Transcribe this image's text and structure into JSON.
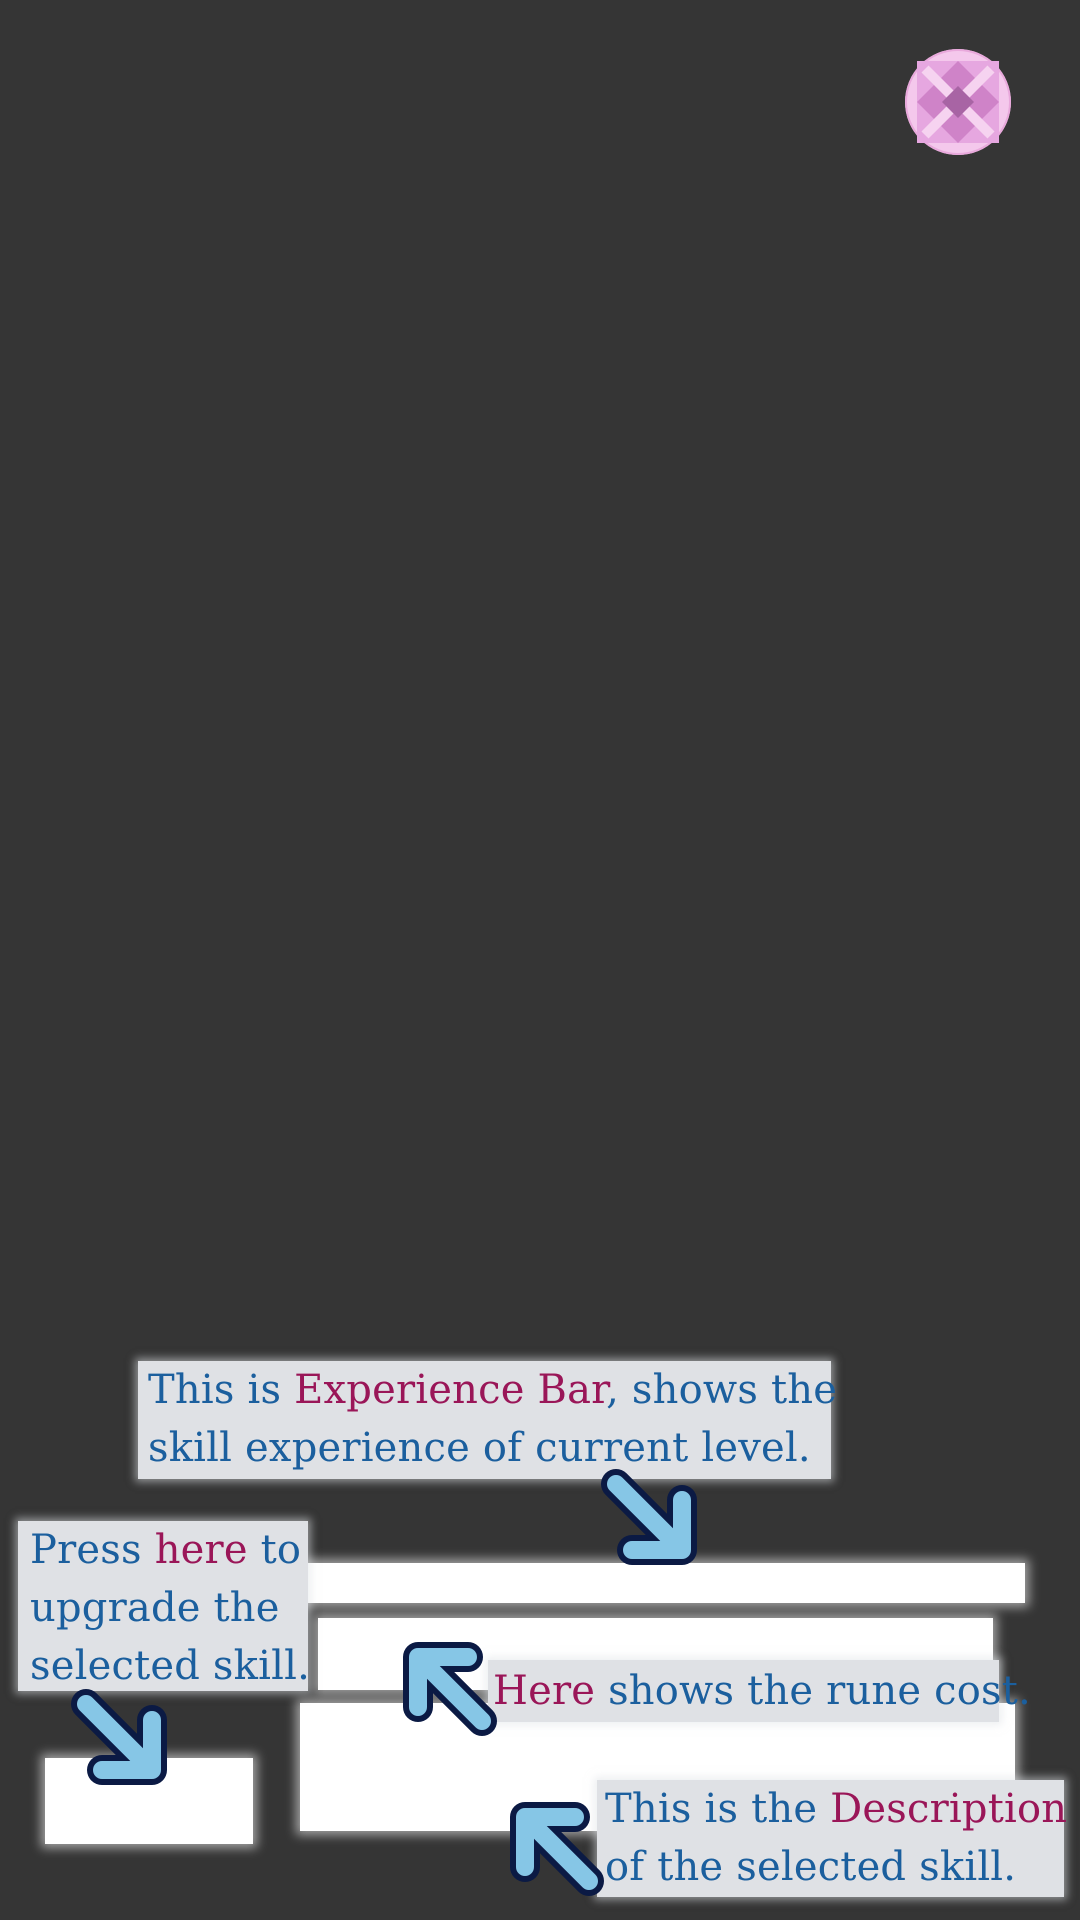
{
  "close_button": {
    "icon": "close-icon",
    "color": "#f4c8ec",
    "mark_color": "#cf83c8"
  },
  "tips": {
    "experience_bar": {
      "line1_pre": "This is ",
      "line1_highlight": "Experience Bar",
      "line1_post": ", shows the",
      "line2": "skill experience of current level."
    },
    "upgrade": {
      "line1_pre": "Press ",
      "line1_highlight": "here",
      "line1_post": " to",
      "line2": "upgrade the",
      "line3": "selected skill."
    },
    "rune_cost": {
      "highlight": "Here",
      "rest": " shows the rune cost."
    },
    "description": {
      "line1_pre": "This is the ",
      "line1_highlight": "Description",
      "line2": "of the selected skill."
    }
  },
  "colors": {
    "background": "#353535",
    "text": "#1b5f9e",
    "highlight": "#9a1658",
    "callout_bg": "#dfe1e5",
    "arrow_fill": "#86c6e6",
    "arrow_stroke": "#0b1a44"
  }
}
